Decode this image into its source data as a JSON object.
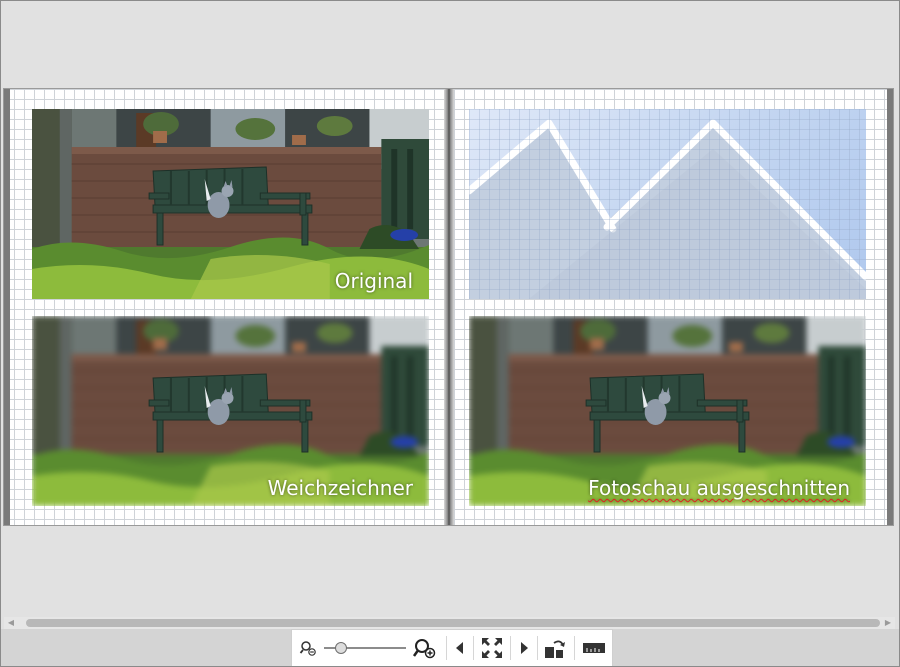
{
  "book": {
    "captions": {
      "original": "Original",
      "soft_focus": "Weichzeichner",
      "slideshow_cutout": "Fotoschau ausgeschnitten"
    },
    "placeholder_icon": "mountain-placeholder-icon"
  },
  "toolbar": {
    "zoom_level": 0.15,
    "icons": [
      "zoom-out-icon",
      "zoom-slider",
      "zoom-in-icon",
      "previous-page-icon",
      "fit-to-window-icon",
      "next-page-icon",
      "swap-pages-icon",
      "page-width-icon"
    ]
  },
  "colors": {
    "background": "#e1e1e1",
    "grid": "#cfd3d8",
    "placeholder_sky": "#c7daf2",
    "caption_text": "#ffffff",
    "spell_underline": "#e02020"
  }
}
